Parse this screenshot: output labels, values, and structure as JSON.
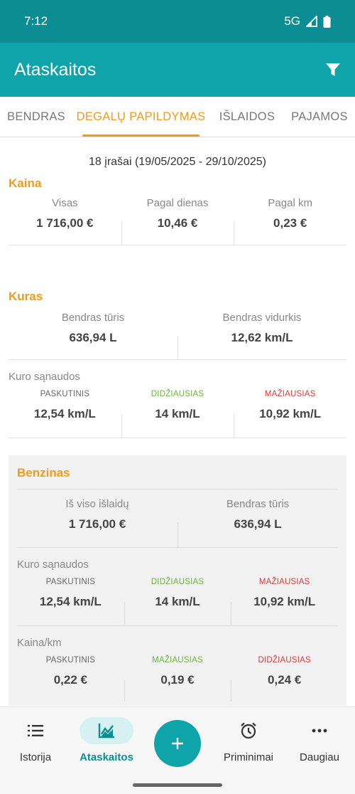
{
  "status": {
    "time": "7:12",
    "network": "5G"
  },
  "appbar": {
    "title": "Ataskaitos"
  },
  "tabs": [
    {
      "label": "BENDRAS"
    },
    {
      "label": "DEGALŲ PAPILDYMAS"
    },
    {
      "label": "IŠLAIDOS"
    },
    {
      "label": "PAJAMOS"
    }
  ],
  "summary": "18 įrašai (19/05/2025 - 29/10/2025)",
  "kaina": {
    "title": "Kaina",
    "cells": [
      {
        "label": "Visas",
        "value": "1 716,00 €"
      },
      {
        "label": "Pagal dienas",
        "value": "10,46 €"
      },
      {
        "label": "Pagal km",
        "value": "0,23 €"
      }
    ]
  },
  "kuras": {
    "title": "Kuras",
    "cells": [
      {
        "label": "Bendras tūris",
        "value": "636,94 L"
      },
      {
        "label": "Bendras vidurkis",
        "value": "12,62 km/L"
      }
    ],
    "consumption_label": "Kuro sąnaudos",
    "consumption": [
      {
        "tag": "PASKUTINIS",
        "value": "12,54 km/L"
      },
      {
        "tag": "DIDŽIAUSIAS",
        "value": "14 km/L"
      },
      {
        "tag": "MAŽIAUSIAS",
        "value": "10,92 km/L"
      }
    ]
  },
  "benzinas": {
    "title": "Benzinas",
    "cells": [
      {
        "label": "Iš viso išlaidų",
        "value": "1 716,00 €"
      },
      {
        "label": "Bendras tūris",
        "value": "636,94 L"
      }
    ],
    "consumption_label": "Kuro sąnaudos",
    "consumption": [
      {
        "tag": "PASKUTINIS",
        "value": "12,54 km/L"
      },
      {
        "tag": "DIDŽIAUSIAS",
        "value": "14 km/L"
      },
      {
        "tag": "MAŽIAUSIAS",
        "value": "10,92 km/L"
      }
    ],
    "price_label": "Kaina/km",
    "price": [
      {
        "tag": "PASKUTINIS",
        "value": "0,22 €"
      },
      {
        "tag": "MAŽIAUSIAS",
        "value": "0,19 €"
      },
      {
        "tag": "DIDŽIAUSIAS",
        "value": "0,24 €"
      }
    ]
  },
  "nav": {
    "items": [
      {
        "label": "Istorija"
      },
      {
        "label": "Ataskaitos"
      },
      {
        "label": "Priminimai"
      },
      {
        "label": "Daugiau"
      }
    ]
  },
  "colors": {
    "primary": "#0fa3aa",
    "status_bar": "#0b8d93",
    "accent": "#f39a17",
    "green": "#6cb33e",
    "red": "#d83b3b"
  }
}
